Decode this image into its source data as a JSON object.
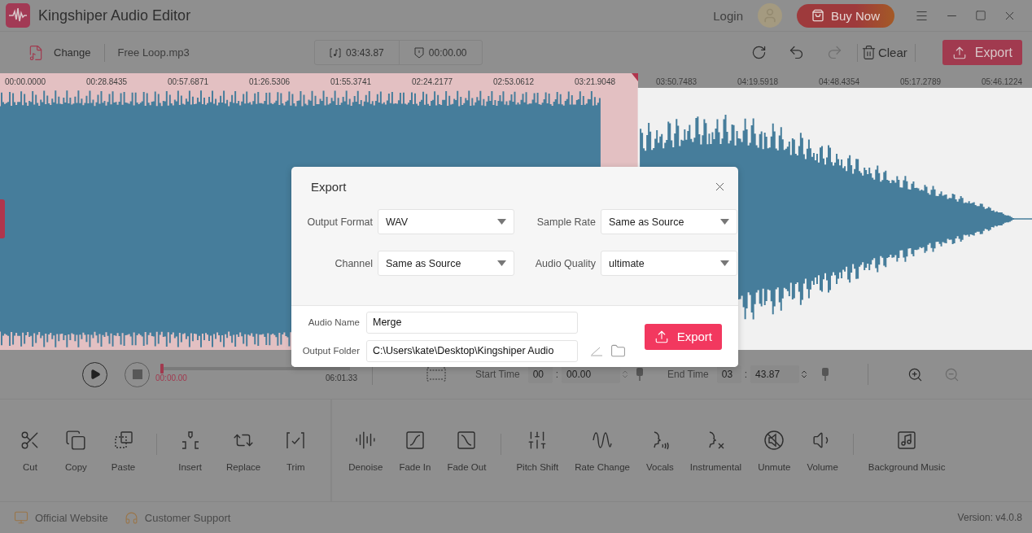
{
  "app": {
    "title": "Kingshiper Audio Editor",
    "login": "Login",
    "buy": "Buy Now"
  },
  "toolbar": {
    "change": "Change",
    "file": "Free Loop.mp3",
    "duration": "03:43.87",
    "position": "00:00.00",
    "clear": "Clear",
    "export": "Export"
  },
  "ruler": [
    "00:00.0000",
    "00:28.8435",
    "00:57.6871",
    "01:26.5306",
    "01:55.3741",
    "02:24.2177",
    "02:53.0612",
    "03:21.9048",
    "03:50.7483",
    "04:19.5918",
    "04:48.4354",
    "05:17.2789",
    "05:46.1224"
  ],
  "selection": {
    "level": 0.618
  },
  "playback": {
    "level": 0,
    "current": "00:00.00",
    "total": "06:01.33"
  },
  "range": {
    "start_label": "Start Time",
    "start_min": "00",
    "start_sep": ":",
    "start_sec": "00.00",
    "end_label": "End Time",
    "end_min": "03",
    "end_sep": ":",
    "end_sec": "43.87"
  },
  "tool_panels": [
    {
      "groups": [
        [
          {
            "kind": "cut",
            "label": "Cut"
          },
          {
            "kind": "copy",
            "label": "Copy"
          },
          {
            "kind": "paste",
            "label": "Paste"
          }
        ],
        [
          {
            "kind": "insert",
            "label": "Insert"
          },
          {
            "kind": "replace",
            "label": "Replace"
          },
          {
            "kind": "trim",
            "label": "Trim"
          }
        ]
      ]
    },
    {
      "groups": [
        [
          {
            "kind": "denoise",
            "label": "Denoise"
          },
          {
            "kind": "fadein",
            "label": "Fade In"
          },
          {
            "kind": "fadeout",
            "label": "Fade Out"
          }
        ],
        [
          {
            "kind": "pitch",
            "label": "Pitch Shift"
          },
          {
            "kind": "rate",
            "label": "Rate Change"
          },
          {
            "kind": "vocals",
            "label": "Vocals"
          },
          {
            "kind": "instrumental",
            "label": "Instrumental"
          },
          {
            "kind": "unmute",
            "label": "Unmute"
          },
          {
            "kind": "volume",
            "label": "Volume"
          }
        ],
        [
          {
            "kind": "music",
            "label": "Background Music"
          }
        ]
      ]
    }
  ],
  "footer": {
    "website": "Official Website",
    "support": "Customer Support",
    "version": "Version: v4.0.8"
  },
  "dialog": {
    "title": "Export",
    "settings": [
      {
        "label": "Output Format",
        "value": "WAV"
      },
      {
        "label": "Sample Rate",
        "value": "Same as Source"
      },
      {
        "label": "Channel",
        "value": "Same as Source"
      },
      {
        "label": "Audio Quality",
        "value": "ultimate"
      }
    ],
    "audio_name_label": "Audio Name",
    "audio_name": "Merge",
    "folder_label": "Output Folder",
    "folder": "C:\\Users\\kate\\Desktop\\Kingshiper Audio",
    "export": "Export"
  }
}
